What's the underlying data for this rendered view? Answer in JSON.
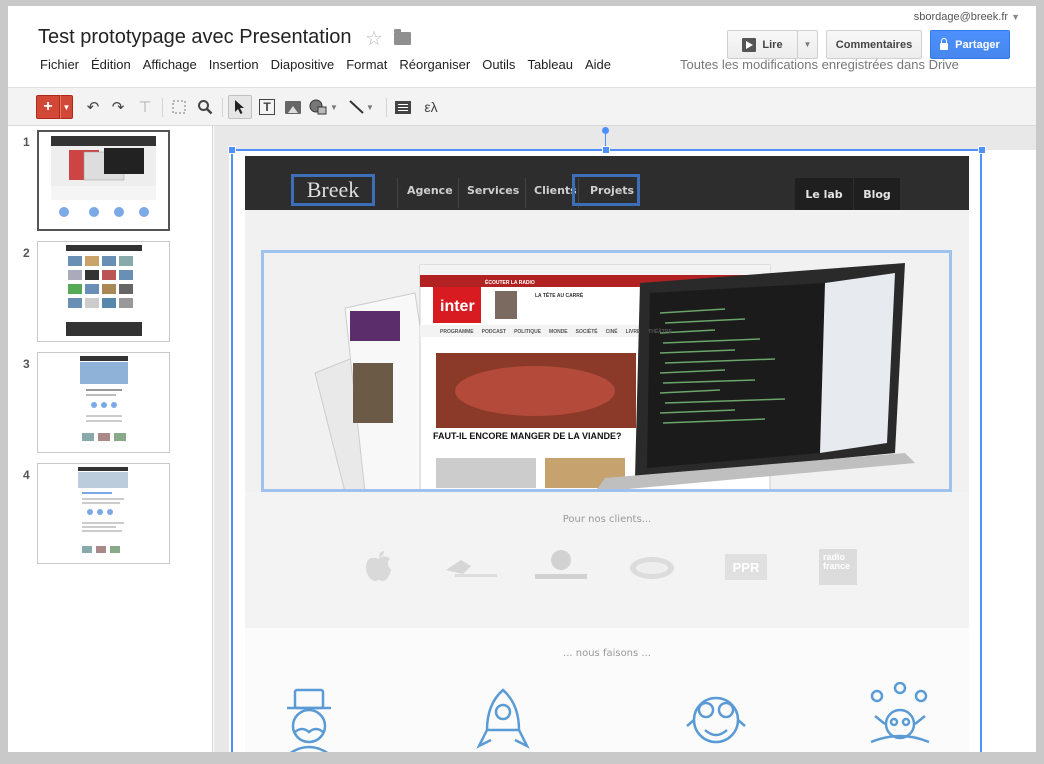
{
  "doc": {
    "title": "Test prototypage avec Presentation",
    "user": "sbordage@breek.fr"
  },
  "menu": [
    "Fichier",
    "Édition",
    "Affichage",
    "Insertion",
    "Diapositive",
    "Format",
    "Réorganiser",
    "Outils",
    "Tableau",
    "Aide"
  ],
  "save_status": "Toutes les modifications enregistrées dans Drive",
  "buttons": {
    "present": "Lire",
    "comments": "Commentaires",
    "share": "Partager"
  },
  "toolbar": {
    "equation_symbol": "ελ"
  },
  "slides": [
    {
      "num": "1",
      "selected": true
    },
    {
      "num": "2",
      "selected": false
    },
    {
      "num": "3",
      "selected": false
    },
    {
      "num": "4",
      "selected": false
    }
  ],
  "site": {
    "logo": "Breek",
    "nav": [
      "Agence",
      "Services",
      "Clients",
      "Projets"
    ],
    "nav_right": [
      "Le lab",
      "Blog"
    ],
    "clients_title": "Pour nos clients...",
    "clients": [
      "PPR",
      "radio france"
    ],
    "services_title": "... nous faisons ...",
    "hero": {
      "headline": "FAUT-IL ENCORE MANGER DE LA VIANDE?",
      "brand": "inter",
      "tab_listen": "ÉCOUTER LA RADIO",
      "tab_live": "LA TÊTE AU CARRÉ",
      "nav_items": [
        "PROGRAMME",
        "PODCAST",
        "POLITIQUE",
        "MONDE",
        "SOCIÉTÉ",
        "CINÉ",
        "LIVRE",
        "THÉÂTRE"
      ]
    }
  }
}
